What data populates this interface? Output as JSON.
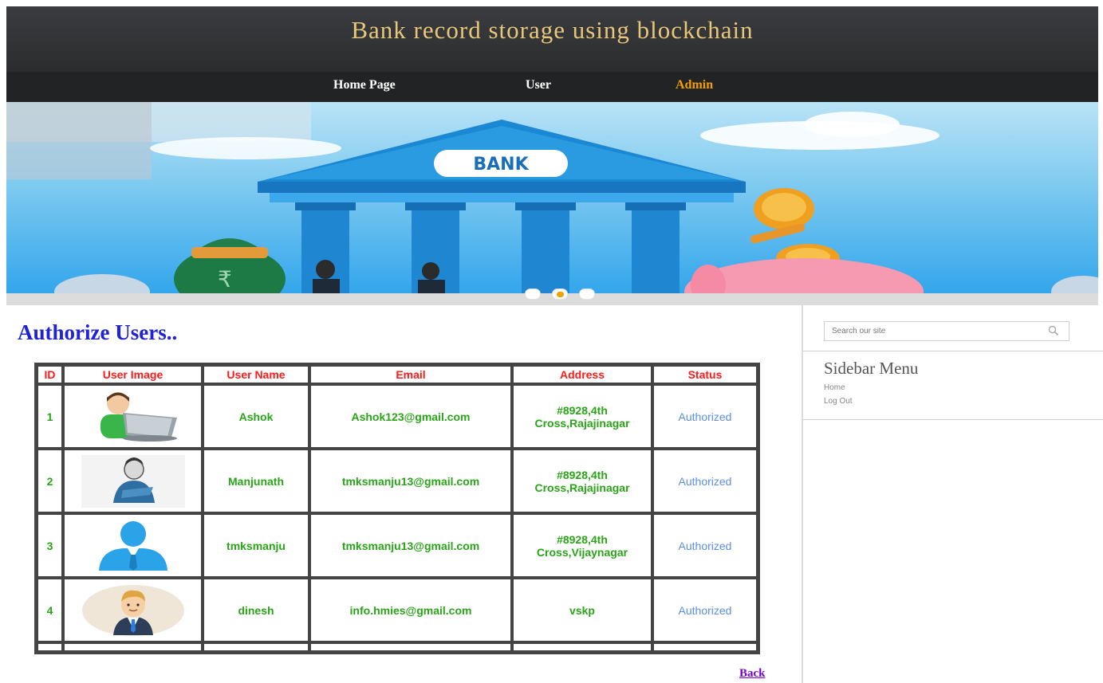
{
  "header": {
    "title": "Bank record storage using blockchain"
  },
  "nav": {
    "items": [
      {
        "label": "Home Page",
        "active": false
      },
      {
        "label": "User",
        "active": false
      },
      {
        "label": "Admin",
        "active": true
      }
    ]
  },
  "banner": {
    "sign_text": "BANK",
    "rupee_symbol": "₹",
    "slide_count": 3,
    "active_slide": 2
  },
  "main": {
    "heading": "Authorize Users..",
    "table": {
      "columns": [
        "ID",
        "User Image",
        "User Name",
        "Email",
        "Address",
        "Status"
      ],
      "rows": [
        {
          "id": "1",
          "avatar": "laptop-user-avatar",
          "name": "Ashok",
          "email": "Ashok123@gmail.com",
          "address_line1": "#8928,4th",
          "address_line2": "Cross,Rajajinagar",
          "status": "Authorized"
        },
        {
          "id": "2",
          "avatar": "man-sketch-avatar",
          "name": "Manjunath",
          "email": "tmksmanju13@gmail.com",
          "address_line1": "#8928,4th",
          "address_line2": "Cross,Rajajinagar",
          "status": "Authorized"
        },
        {
          "id": "3",
          "avatar": "blue-silhouette-avatar",
          "name": "tmksmanju",
          "email": "tmksmanju13@gmail.com",
          "address_line1": "#8928,4th",
          "address_line2": "Cross,Vijaynagar",
          "status": "Authorized"
        },
        {
          "id": "4",
          "avatar": "businessman-avatar",
          "name": "dinesh",
          "email": "info.hmies@gmail.com",
          "address_line1": "vskp",
          "address_line2": "",
          "status": "Authorized"
        }
      ]
    },
    "back_label": "Back"
  },
  "sidebar": {
    "search_placeholder": "Search our site",
    "title": "Sidebar Menu",
    "links": [
      "Home",
      "Log Out"
    ]
  },
  "colors": {
    "header_bg": "#2f3033",
    "title": "#e8c77a",
    "nav_active": "#f2a000",
    "heading": "#1f22d6",
    "table_header_text": "#ff1a1a",
    "table_cell_text": "#2aa418",
    "status_text": "#5b8fe0",
    "back_link": "#7a00cc"
  }
}
